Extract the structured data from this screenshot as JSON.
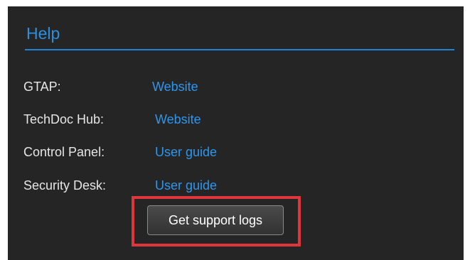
{
  "help": {
    "title": "Help",
    "rows": [
      {
        "label": "GTAP:",
        "link": "Website"
      },
      {
        "label": "TechDoc Hub:",
        "link": "Website"
      },
      {
        "label": "Control Panel:",
        "link": "User guide"
      },
      {
        "label": "Security Desk:",
        "link": "User guide"
      }
    ],
    "support_button_label": "Get support logs"
  },
  "colors": {
    "panel_bg": "#252526",
    "accent": "#2b8fe0",
    "link": "#2f96ec",
    "highlight": "#e0353a"
  }
}
